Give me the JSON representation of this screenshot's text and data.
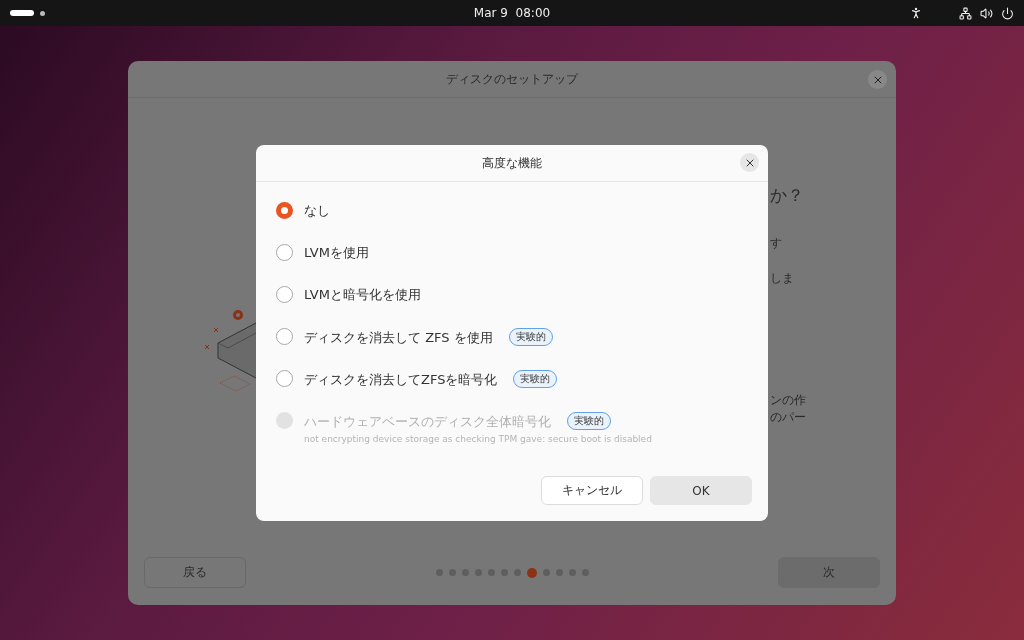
{
  "top_bar": {
    "clock": "Mar 9  08:00"
  },
  "window": {
    "title": "ディスクのセットアップ",
    "background_texts": [
      {
        "text": "か？",
        "kind": "heading"
      },
      {
        "text": "す",
        "kind": "body"
      },
      {
        "text": "しま",
        "kind": "body"
      },
      {
        "text": "ンの作",
        "kind": "body"
      },
      {
        "text": "のパー",
        "kind": "body"
      }
    ],
    "back_button": "戻る",
    "next_button": "次",
    "pages": [
      {
        "selected": false
      },
      {
        "selected": false
      },
      {
        "selected": false
      },
      {
        "selected": false
      },
      {
        "selected": false
      },
      {
        "selected": false
      },
      {
        "selected": false
      },
      {
        "selected": true
      },
      {
        "selected": false
      },
      {
        "selected": false
      },
      {
        "selected": false
      },
      {
        "selected": false
      }
    ]
  },
  "dialog": {
    "title": "高度な機能",
    "options": [
      {
        "label": "なし",
        "selected": true,
        "disabled": false
      },
      {
        "label": "LVMを使用",
        "selected": false,
        "disabled": false
      },
      {
        "label": "LVMと暗号化を使用",
        "selected": false,
        "disabled": false
      },
      {
        "label": "ディスクを消去して ZFS を使用",
        "selected": false,
        "disabled": false,
        "badge": "実験的"
      },
      {
        "label": "ディスクを消去してZFSを暗号化",
        "selected": false,
        "disabled": false,
        "badge": "実験的"
      },
      {
        "label": "ハードウェアベースのディスク全体暗号化",
        "selected": false,
        "disabled": true,
        "badge": "実験的",
        "note": "not encrypting device storage as checking TPM gave: secure boot is disabled"
      }
    ],
    "cancel_button": "キャンセル",
    "ok_button": "OK"
  }
}
